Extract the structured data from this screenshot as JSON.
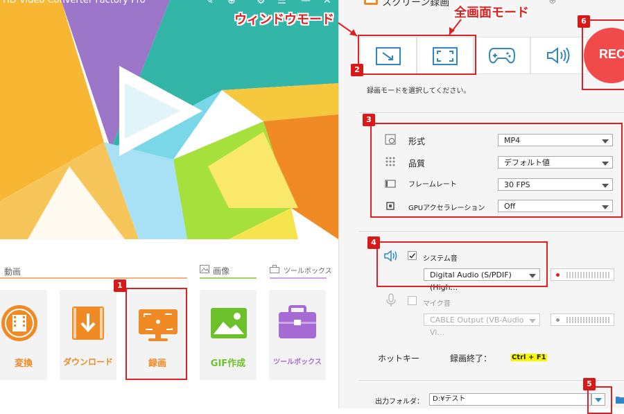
{
  "left_app": {
    "title": "HD Video Converter Factory Pro",
    "titlebar_icons": [
      "wrench-icon",
      "cart-icon",
      "gear-icon",
      "list-icon",
      "minimize-icon",
      "close-icon"
    ],
    "categories": {
      "video": {
        "label": "動画"
      },
      "image": {
        "label": "画像"
      },
      "toolbox": {
        "label": "ツールボックス"
      }
    },
    "tiles": [
      {
        "id": "convert",
        "label": "変換",
        "icon": "film-reel-icon",
        "color": "#f08a24"
      },
      {
        "id": "download",
        "label": "ダウンロード",
        "icon": "download-icon",
        "color": "#f08a24"
      },
      {
        "id": "record",
        "label": "録画",
        "icon": "monitor-record-icon",
        "color": "#f08a24"
      },
      {
        "id": "gif",
        "label": "GIF作成",
        "icon": "image-icon",
        "color": "#6cc12b"
      },
      {
        "id": "toolbox",
        "label": "ツールボックス",
        "icon": "toolbox-icon",
        "color": "#a66bd3"
      }
    ]
  },
  "recorder": {
    "title": "スクリーン録画",
    "modes": [
      {
        "id": "window",
        "icon": "window-mode-icon"
      },
      {
        "id": "fullscreen",
        "icon": "fullscreen-mode-icon"
      },
      {
        "id": "game",
        "icon": "gamepad-icon"
      },
      {
        "id": "audio",
        "icon": "speaker-icon"
      }
    ],
    "rec_label": "REC",
    "mode_hint": "録画モードを選択してください。",
    "settings": [
      {
        "label": "形式",
        "value": "MP4",
        "icon": "format-gear-icon"
      },
      {
        "label": "品質",
        "value": "デフォルト値",
        "icon": "quality-dots-icon"
      },
      {
        "label": "フレームレート",
        "value": "30 FPS",
        "icon": "film-strip-icon"
      },
      {
        "label": "GPUアクセラレーション",
        "value": "Off",
        "icon": "chip-icon"
      }
    ],
    "system_audio": {
      "label": "システム音",
      "checked": true,
      "device": "Digital Audio (S/PDIF) (High..."
    },
    "mic": {
      "label": "マイク音",
      "checked": false,
      "device": "CABLE Output (VB-Audio Vi..."
    },
    "hotkey": {
      "label": "ホットキー",
      "action": "録画終了：",
      "keys": "Ctrl + F1"
    },
    "output": {
      "label": "出力フォルダ：",
      "path": "D:¥テスト"
    }
  },
  "annotations": {
    "window_mode": "ウィンドウモード",
    "fullscreen_mode": "全画面モード",
    "badges": [
      "1",
      "2",
      "3",
      "4",
      "5",
      "6"
    ],
    "accent_color": "#e02020"
  }
}
